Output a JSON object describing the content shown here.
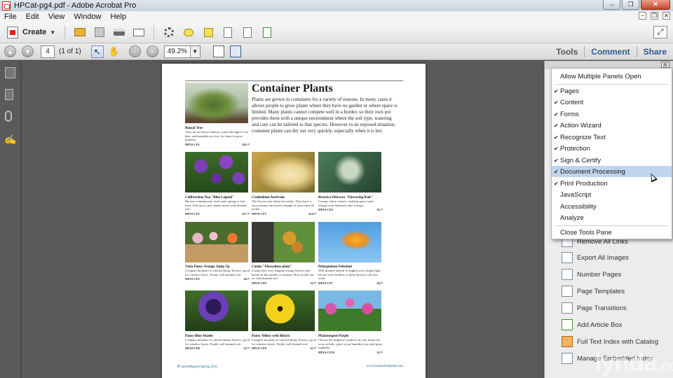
{
  "window": {
    "title": "HPCat-pg4.pdf - Adobe Acrobat Pro",
    "minimize": "−",
    "maximize": "❐",
    "close": "✕"
  },
  "menu": {
    "items": [
      "File",
      "Edit",
      "View",
      "Window",
      "Help"
    ]
  },
  "toolbar": {
    "create_label": "Create",
    "caret": "▼"
  },
  "nav": {
    "page_number": "4",
    "page_of": "(1 of 1)",
    "zoom": "49.2%"
  },
  "right_links": {
    "tools": "Tools",
    "comment": "Comment",
    "share": "Share"
  },
  "panels_menu": {
    "allow_multiple": "Allow Multiple Panels Open",
    "items": [
      {
        "label": "Pages",
        "checked": true
      },
      {
        "label": "Content",
        "checked": true
      },
      {
        "label": "Forms",
        "checked": true
      },
      {
        "label": "Action Wizard",
        "checked": true
      },
      {
        "label": "Recognize Text",
        "checked": true
      },
      {
        "label": "Protection",
        "checked": true
      },
      {
        "label": "Sign & Certify",
        "checked": true
      },
      {
        "label": "Document Processing",
        "checked": true,
        "highlighted": true
      },
      {
        "label": "Print Production",
        "checked": true
      },
      {
        "label": "JavaScript",
        "checked": false
      },
      {
        "label": "Accessibility",
        "checked": false
      },
      {
        "label": "Analyze",
        "checked": false
      }
    ],
    "close_label": "Close Tools Pane"
  },
  "tools_pane": {
    "items": [
      "Remove All Links",
      "Export All Images",
      "Number Pages",
      "Page Templates",
      "Page Transitions",
      "Add Article Box",
      "Full Text Index with Catalog",
      "Manage Embedded Index"
    ]
  },
  "document": {
    "title": "Container Plants",
    "intro": "Plants are grown in containers for a variety of reasons. In many cases it allows people to grow plants where they have no garden or where space is limited. Many plants cannot compete well in a border, so their own pot provides them with a unique environment where the soil type, watering and care can be tailored to that species. However in an exposed situation, container plants can dry out very quickly, especially when it is hot.",
    "products": [
      {
        "name": "Bonsai Tree",
        "desc": "They do not thrive indoors, where the light is too dim, and humidity too low, for them to grow properly.",
        "code": "HP10-CP1",
        "price": "$45.⁹⁹"
      },
      {
        "name": "Calibrachoa Noa \"Blue Legend\"",
        "desc": "Blooms continuously from early spring to first frost. Full sun or part shade, moist well-drained soil.",
        "code": "HP10-CP2",
        "price": "$17.⁹⁹"
      },
      {
        "name": "Cymbidium Aestivum",
        "desc": "The flowers last about ten weeks. They have a waxy texture and reach a height of more than 20 inches.",
        "code": "HP10-CP3",
        "price": "$14.⁹⁹"
      },
      {
        "name": "Brassica Oleracea \"Flowering Kale\"",
        "desc": "Creamy white centres, medium green outer foliage with flattened outer foliage.",
        "code": "HP10-CP4",
        "price": "$5.⁹⁹"
      },
      {
        "name": "Viola Pansy Orange Jump Up",
        "desc": "Compact mounds of colorful dainty flowers, good for window boxes. Fertile well drained soil.",
        "code": "HP10-CP5",
        "price": "$4.⁹⁹"
      },
      {
        "name": "Cotula \"Pincushion plant\"",
        "desc": "Cotula have very fragrant orange flowers that bloom in the middle of summer. Best in full sun on well-drained soil.",
        "code": "HP10-CP6",
        "price": "$3.⁹⁹"
      },
      {
        "name": "Pelargonium Peltatum",
        "desc": "Well drained neutral to slightly acid, bright light. Do not over-fertilize or these flowers will lose scent.",
        "code": "HP10-CP7",
        "price": "$4.⁹⁹"
      },
      {
        "name": "Pansy Blue Shades",
        "desc": "Compact mounds of colorful dainty flowers, good for window boxes. Fertile well drained soil.",
        "code": "HP10-CP8",
        "price": "$3.⁹⁹"
      },
      {
        "name": "Pansy Yellow with Blotch",
        "desc": "Compact mounds of colorful dainty flowers, good for window boxes. Fertile well drained soil.",
        "code": "HP10-CP9",
        "price": "$3.⁹⁹"
      },
      {
        "name": "Phalaenopsis Purple",
        "desc": "Choose the brightest windows in your house for your orchids, place on an humidity tray and spray regularly.",
        "code": "HP10-CP10",
        "price": "$2.⁹⁹"
      }
    ],
    "footer": {
      "page_num": "4",
      "left": "hansel&petal Spring 2011",
      "right": "www.hanselAndpetal.com"
    }
  },
  "watermark": {
    "text": "lynda",
    "suffix": ".com"
  }
}
